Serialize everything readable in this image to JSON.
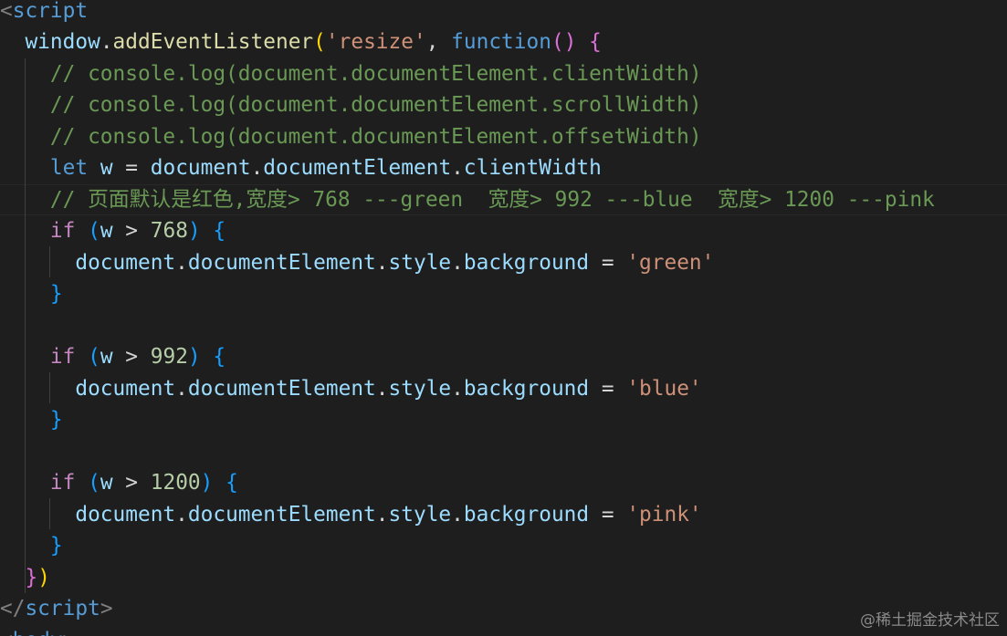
{
  "editor": {
    "lines": [
      [
        {
          "t": "<",
          "c": "tag"
        },
        {
          "t": "script",
          "c": "tagname"
        }
      ],
      [
        {
          "t": "  "
        },
        {
          "t": "window",
          "c": "ident"
        },
        {
          "t": ".",
          "c": "op"
        },
        {
          "t": "addEventListener",
          "c": "fn"
        },
        {
          "t": "(",
          "c": "b1"
        },
        {
          "t": "'resize'",
          "c": "str"
        },
        {
          "t": ", ",
          "c": "op"
        },
        {
          "t": "function",
          "c": "kw"
        },
        {
          "t": "()",
          "c": "b2"
        },
        {
          "t": " "
        },
        {
          "t": "{",
          "c": "b2"
        }
      ],
      [
        {
          "t": "    "
        },
        {
          "t": "// console.log(document.documentElement.clientWidth)",
          "c": "cmt"
        }
      ],
      [
        {
          "t": "    "
        },
        {
          "t": "// console.log(document.documentElement.scrollWidth)",
          "c": "cmt"
        }
      ],
      [
        {
          "t": "    "
        },
        {
          "t": "// console.log(document.documentElement.offsetWidth)",
          "c": "cmt"
        }
      ],
      [
        {
          "t": "    "
        },
        {
          "t": "let",
          "c": "kw"
        },
        {
          "t": " "
        },
        {
          "t": "w",
          "c": "var"
        },
        {
          "t": " = ",
          "c": "op"
        },
        {
          "t": "document",
          "c": "var"
        },
        {
          "t": ".",
          "c": "op"
        },
        {
          "t": "documentElement",
          "c": "var"
        },
        {
          "t": ".",
          "c": "op"
        },
        {
          "t": "clientWidth",
          "c": "var"
        }
      ],
      [
        {
          "t": "    "
        },
        {
          "t": "// 页面默认是红色,宽度> 768 ---green  宽度> 992 ---blue  宽度> 1200 ---pink",
          "c": "cmt"
        }
      ],
      [
        {
          "t": "    "
        },
        {
          "t": "if",
          "c": "ctrl"
        },
        {
          "t": " "
        },
        {
          "t": "(",
          "c": "b3"
        },
        {
          "t": "w",
          "c": "var"
        },
        {
          "t": " > ",
          "c": "op"
        },
        {
          "t": "768",
          "c": "num"
        },
        {
          "t": ")",
          "c": "b3"
        },
        {
          "t": " "
        },
        {
          "t": "{",
          "c": "b3"
        }
      ],
      [
        {
          "t": "      "
        },
        {
          "t": "document",
          "c": "var"
        },
        {
          "t": ".",
          "c": "op"
        },
        {
          "t": "documentElement",
          "c": "var"
        },
        {
          "t": ".",
          "c": "op"
        },
        {
          "t": "style",
          "c": "var"
        },
        {
          "t": ".",
          "c": "op"
        },
        {
          "t": "background",
          "c": "var"
        },
        {
          "t": " = ",
          "c": "op"
        },
        {
          "t": "'green'",
          "c": "str"
        }
      ],
      [
        {
          "t": "    "
        },
        {
          "t": "}",
          "c": "b3"
        }
      ],
      [],
      [
        {
          "t": "    "
        },
        {
          "t": "if",
          "c": "ctrl"
        },
        {
          "t": " "
        },
        {
          "t": "(",
          "c": "b3"
        },
        {
          "t": "w",
          "c": "var"
        },
        {
          "t": " > ",
          "c": "op"
        },
        {
          "t": "992",
          "c": "num"
        },
        {
          "t": ")",
          "c": "b3"
        },
        {
          "t": " "
        },
        {
          "t": "{",
          "c": "b3"
        }
      ],
      [
        {
          "t": "      "
        },
        {
          "t": "document",
          "c": "var"
        },
        {
          "t": ".",
          "c": "op"
        },
        {
          "t": "documentElement",
          "c": "var"
        },
        {
          "t": ".",
          "c": "op"
        },
        {
          "t": "style",
          "c": "var"
        },
        {
          "t": ".",
          "c": "op"
        },
        {
          "t": "background",
          "c": "var"
        },
        {
          "t": " = ",
          "c": "op"
        },
        {
          "t": "'blue'",
          "c": "str"
        }
      ],
      [
        {
          "t": "    "
        },
        {
          "t": "}",
          "c": "b3"
        }
      ],
      [],
      [
        {
          "t": "    "
        },
        {
          "t": "if",
          "c": "ctrl"
        },
        {
          "t": " "
        },
        {
          "t": "(",
          "c": "b3"
        },
        {
          "t": "w",
          "c": "var"
        },
        {
          "t": " > ",
          "c": "op"
        },
        {
          "t": "1200",
          "c": "num"
        },
        {
          "t": ")",
          "c": "b3"
        },
        {
          "t": " "
        },
        {
          "t": "{",
          "c": "b3"
        }
      ],
      [
        {
          "t": "      "
        },
        {
          "t": "document",
          "c": "var"
        },
        {
          "t": ".",
          "c": "op"
        },
        {
          "t": "documentElement",
          "c": "var"
        },
        {
          "t": ".",
          "c": "op"
        },
        {
          "t": "style",
          "c": "var"
        },
        {
          "t": ".",
          "c": "op"
        },
        {
          "t": "background",
          "c": "var"
        },
        {
          "t": " = ",
          "c": "op"
        },
        {
          "t": "'pink'",
          "c": "str"
        }
      ],
      [
        {
          "t": "    "
        },
        {
          "t": "}",
          "c": "b3"
        }
      ],
      [
        {
          "t": "  "
        },
        {
          "t": "}",
          "c": "b2"
        },
        {
          "t": ")",
          "c": "b1"
        }
      ],
      [
        {
          "t": "</",
          "c": "tag"
        },
        {
          "t": "script",
          "c": "tagname"
        },
        {
          "t": ">",
          "c": "tag"
        }
      ],
      [
        {
          "t": "<",
          "c": "tag"
        },
        {
          "t": "body",
          "c": "tagname"
        },
        {
          "t": ">",
          "c": "tag"
        }
      ]
    ]
  },
  "watermark": "@稀土掘金技术社区",
  "colors": {
    "background": "#1e1e1e",
    "comment": "#6a9955",
    "string": "#ce9178",
    "keyword": "#569cd6",
    "control": "#c586c0",
    "variable": "#9cdcfe",
    "number": "#b5cea8",
    "function": "#dcdcaa"
  }
}
